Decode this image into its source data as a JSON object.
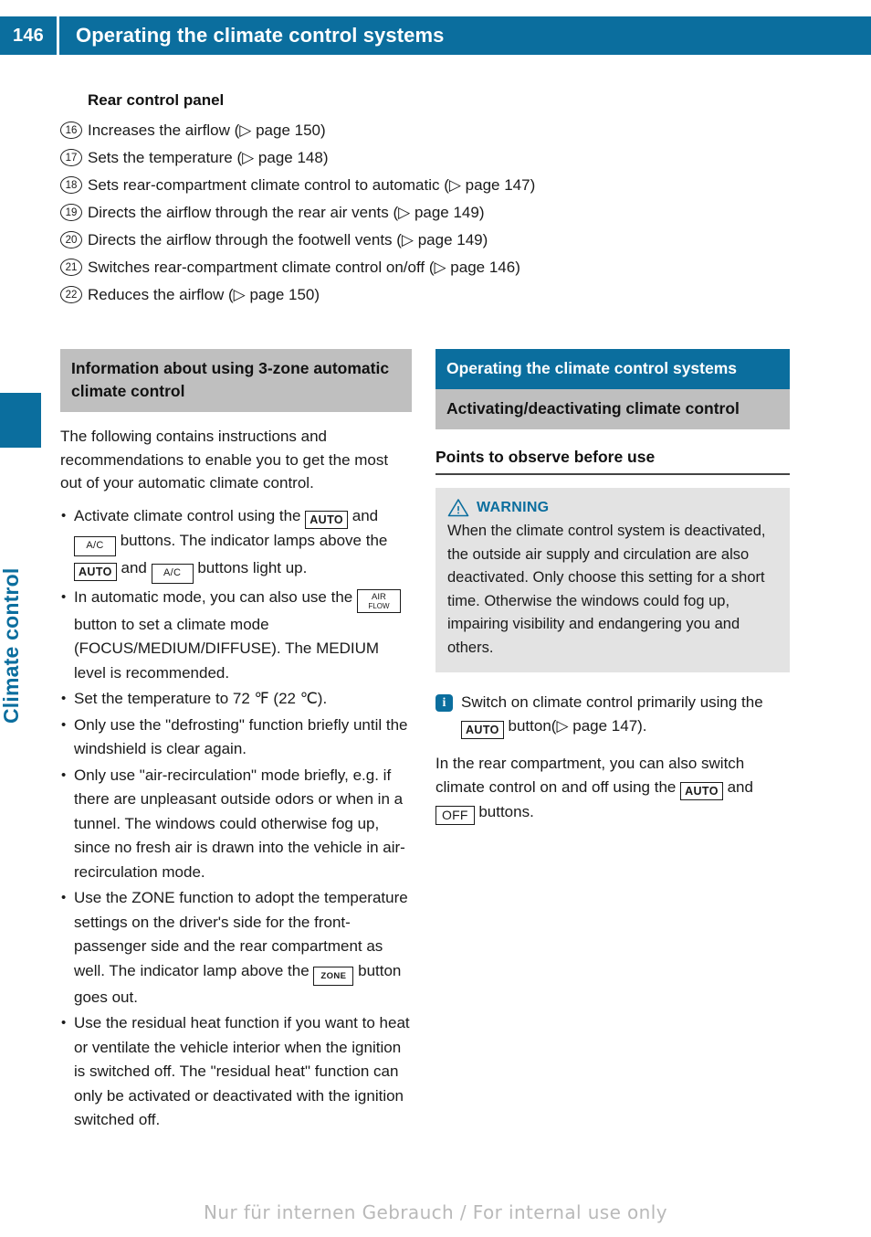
{
  "header": {
    "page_number": "146",
    "title": "Operating the climate control systems"
  },
  "sidebar": {
    "chapter_label": "Climate control"
  },
  "rear_control_panel": {
    "heading": "Rear control panel",
    "items": [
      {
        "number": "16",
        "text": "Increases the airflow (▷ page 150)"
      },
      {
        "number": "17",
        "text": "Sets the temperature (▷ page 148)"
      },
      {
        "number": "18",
        "text": "Sets rear-compartment climate control to automatic (▷ page 147)"
      },
      {
        "number": "19",
        "text": "Directs the airflow through the rear air vents (▷ page 149)"
      },
      {
        "number": "20",
        "text": "Directs the airflow through the footwell vents (▷ page 149)"
      },
      {
        "number": "21",
        "text": "Switches rear-compartment climate control on/off (▷ page 146)"
      },
      {
        "number": "22",
        "text": "Reduces the airflow (▷ page 150)"
      }
    ]
  },
  "left_column": {
    "section_heading": "Information about using 3-zone automatic climate control",
    "intro": "The following contains instructions and recommendations to enable you to get the most out of your automatic climate control.",
    "bullets": [
      {
        "parts": [
          {
            "type": "text",
            "value": "Activate climate control using the "
          },
          {
            "type": "button",
            "style": "auto",
            "value": "AUTO"
          },
          {
            "type": "text",
            "value": " and "
          },
          {
            "type": "button",
            "style": "ac",
            "value": "A/C"
          },
          {
            "type": "text",
            "value": " buttons. The indicator lamps above the "
          },
          {
            "type": "button",
            "style": "auto",
            "value": "AUTO"
          },
          {
            "type": "text",
            "value": " and "
          },
          {
            "type": "button",
            "style": "ac",
            "value": "A/C"
          },
          {
            "type": "text",
            "value": " buttons light up."
          }
        ]
      },
      {
        "parts": [
          {
            "type": "text",
            "value": "In automatic mode, you can also use the "
          },
          {
            "type": "button",
            "style": "airflow",
            "value": "AIR FLOW",
            "line1": "AIR",
            "line2": "FLOW"
          },
          {
            "type": "text",
            "value": " button to set a climate mode (FOCUS/MEDIUM/DIFFUSE). The MEDIUM level is recommended."
          }
        ]
      },
      {
        "parts": [
          {
            "type": "text",
            "value": "Set the temperature to 72 ℉ (22 ℃)."
          }
        ]
      },
      {
        "parts": [
          {
            "type": "text",
            "value": "Only use the \"defrosting\" function briefly until the windshield is clear again."
          }
        ]
      },
      {
        "parts": [
          {
            "type": "text",
            "value": "Only use \"air-recirculation\" mode briefly, e.g. if there are unpleasant outside odors or when in a tunnel. The windows could otherwise fog up, since no fresh air is drawn into the vehicle in air-recirculation mode."
          }
        ]
      },
      {
        "parts": [
          {
            "type": "text",
            "value": "Use the ZONE function to adopt the temperature settings on the driver's side for the front-passenger side and the rear compartment as well. The indicator lamp above the "
          },
          {
            "type": "button",
            "style": "zone",
            "value": "ZONE"
          },
          {
            "type": "text",
            "value": " button goes out."
          }
        ]
      },
      {
        "parts": [
          {
            "type": "text",
            "value": "Use the residual heat function if you want to heat or ventilate the vehicle interior when the ignition is switched off. The \"residual heat\" function can only be activated or deactivated with the ignition switched off."
          }
        ]
      }
    ]
  },
  "right_column": {
    "section_heading": "Operating the climate control systems",
    "subsection_heading": "Activating/deactivating climate control",
    "topic_heading": "Points to observe before use",
    "warning": {
      "icon": "warning-triangle-icon",
      "label": "WARNING",
      "body": "When the climate control system is deactivated, the outside air supply and circulation are also deactivated. Only choose this setting for a short time. Otherwise the windows could fog up, impairing visibility and endangering you and others."
    },
    "note": {
      "icon": "info-icon",
      "icon_glyph": "i",
      "parts": [
        {
          "type": "text",
          "value": "Switch on climate control primarily using the "
        },
        {
          "type": "button",
          "style": "auto",
          "value": "AUTO"
        },
        {
          "type": "text",
          "value": " button(▷ page 147)."
        }
      ]
    },
    "closing_paragraph": {
      "parts": [
        {
          "type": "text",
          "value": "In the rear compartment, you can also switch climate control on and off using the "
        },
        {
          "type": "button",
          "style": "auto",
          "value": "AUTO"
        },
        {
          "type": "text",
          "value": " and "
        },
        {
          "type": "button",
          "style": "off",
          "value": "OFF"
        },
        {
          "type": "text",
          "value": " buttons."
        }
      ]
    }
  },
  "footer": {
    "watermark": "Nur für internen Gebrauch / For internal use only"
  },
  "colors": {
    "brand_blue": "#0b6e9e",
    "heading_gray": "#bfbfbf",
    "warning_bg": "#e3e3e3",
    "text": "#1a1a1a"
  }
}
